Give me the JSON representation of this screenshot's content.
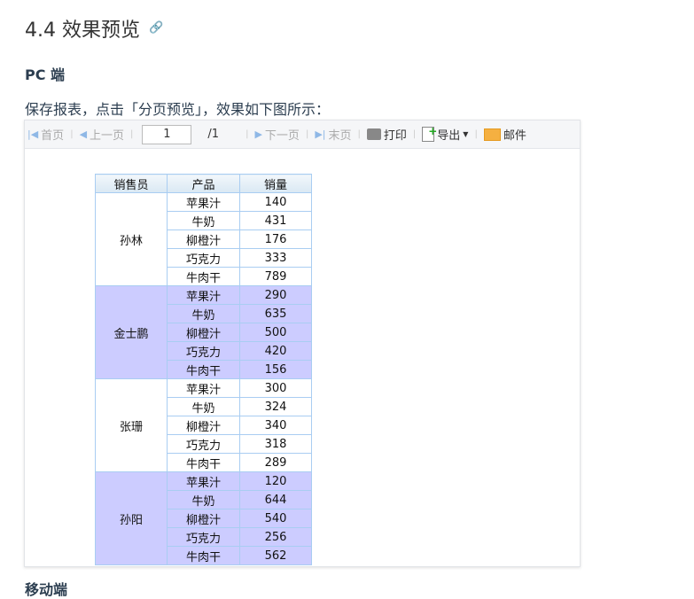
{
  "heading": "4.4 效果预览",
  "link_icon": "🔗",
  "subheading": "PC 端",
  "paragraph": "保存报表，点击「分页预览」，效果如下图所示：",
  "next_heading": "移动端",
  "toolbar": {
    "first": "首页",
    "prev": "上一页",
    "page": "1",
    "total": "/1",
    "next": "下一页",
    "last": "末页",
    "print": "打印",
    "export": "导出",
    "email": "邮件"
  },
  "table": {
    "headers": [
      "销售员",
      "产品",
      "销量"
    ],
    "groups": [
      {
        "name": "孙林",
        "rows": [
          [
            "苹果汁",
            "140"
          ],
          [
            "牛奶",
            "431"
          ],
          [
            "柳橙汁",
            "176"
          ],
          [
            "巧克力",
            "333"
          ],
          [
            "牛肉干",
            "789"
          ]
        ]
      },
      {
        "name": "金士鹏",
        "rows": [
          [
            "苹果汁",
            "290"
          ],
          [
            "牛奶",
            "635"
          ],
          [
            "柳橙汁",
            "500"
          ],
          [
            "巧克力",
            "420"
          ],
          [
            "牛肉干",
            "156"
          ]
        ]
      },
      {
        "name": "张珊",
        "rows": [
          [
            "苹果汁",
            "300"
          ],
          [
            "牛奶",
            "324"
          ],
          [
            "柳橙汁",
            "340"
          ],
          [
            "巧克力",
            "318"
          ],
          [
            "牛肉干",
            "289"
          ]
        ]
      },
      {
        "name": "孙阳",
        "rows": [
          [
            "苹果汁",
            "120"
          ],
          [
            "牛奶",
            "644"
          ],
          [
            "柳橙汁",
            "540"
          ],
          [
            "巧克力",
            "256"
          ],
          [
            "牛肉干",
            "562"
          ]
        ]
      }
    ]
  }
}
